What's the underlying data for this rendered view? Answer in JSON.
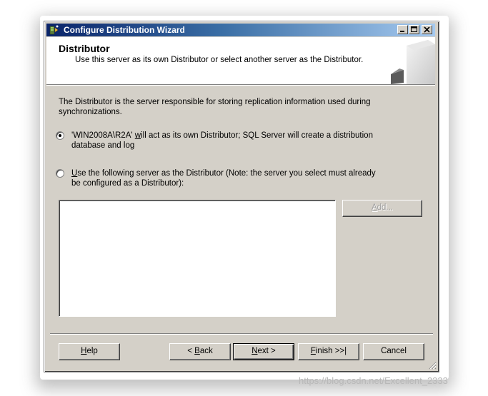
{
  "window": {
    "title": "Configure Distribution Wizard"
  },
  "header": {
    "title": "Distributor",
    "subtitle": "Use this server as its own Distributor or select another server as the Distributor."
  },
  "description": "The Distributor is the server responsible for storing replication information used during synchronizations.",
  "options": {
    "own_distributor": {
      "label_pre": "'WIN2008A\\R2A' ",
      "label_mnemonic": "w",
      "label_post": "ill act as its own Distributor; SQL Server will create a distribution database and log",
      "selected": true
    },
    "other_server": {
      "label_mnemonic": "U",
      "label_post": "se the following server as the Distributor (Note: the server you select must already be configured as a Distributor):",
      "selected": false
    }
  },
  "server_list": [],
  "buttons": {
    "add": {
      "mnemonic": "A",
      "rest": "dd..."
    },
    "help": {
      "mnemonic": "H",
      "rest": "elp"
    },
    "back": {
      "pre": "< ",
      "mnemonic": "B",
      "rest": "ack"
    },
    "next": {
      "mnemonic": "N",
      "rest": "ext >"
    },
    "finish": {
      "mnemonic": "F",
      "rest": "inish >>|"
    },
    "cancel": {
      "label": "Cancel"
    }
  },
  "watermark": "https://blog.csdn.net/Excellent_2333",
  "colors": {
    "title_gradient_start": "#0a246a",
    "title_gradient_end": "#a6caf0",
    "dialog_face": "#d4d0c8"
  }
}
